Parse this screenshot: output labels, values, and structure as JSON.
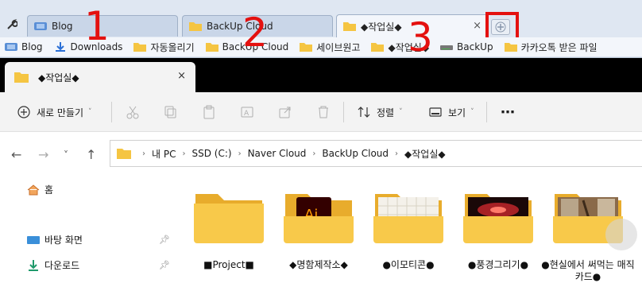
{
  "browser": {
    "tabs": [
      {
        "title": "Blog",
        "icon": "blog-favicon",
        "active": false
      },
      {
        "title": "BackUp Cloud",
        "icon": "folder-icon",
        "active": false
      },
      {
        "title": "◆작업실◆",
        "icon": "folder-icon",
        "active": true
      }
    ],
    "close_glyph": "×",
    "new_tab_glyph": "+"
  },
  "bookmarks": [
    {
      "label": "Blog",
      "icon": "blog-favicon"
    },
    {
      "label": "Downloads",
      "icon": "download-icon"
    },
    {
      "label": "자동올리기",
      "icon": "folder-icon"
    },
    {
      "label": "BackUp Cloud",
      "icon": "folder-icon"
    },
    {
      "label": "세이브원고",
      "icon": "folder-icon"
    },
    {
      "label": "◆작업실◆",
      "icon": "folder-icon"
    },
    {
      "label": "BackUp",
      "icon": "drive-icon"
    },
    {
      "label": "카카오톡 받은 파일",
      "icon": "folder-icon"
    }
  ],
  "annotations": [
    "1",
    "2",
    "3"
  ],
  "explorer": {
    "tab_title": "◆작업실◆",
    "close_glyph": "×",
    "command_bar": {
      "new_label": "새로 만들기",
      "sort_label": "정렬",
      "view_label": "보기",
      "more_glyph": "⋯"
    },
    "breadcrumbs": [
      "내 PC",
      "SSD (C:)",
      "Naver Cloud",
      "BackUp Cloud",
      "◆작업실◆"
    ],
    "sidebar": [
      {
        "label": "홈",
        "icon": "home-icon"
      },
      {
        "label": "바탕 화면",
        "icon": "desktop-icon",
        "pinned": true
      },
      {
        "label": "다운로드",
        "icon": "download-icon",
        "pinned": true
      }
    ],
    "folders": [
      {
        "name": "■Project■",
        "preview": "none"
      },
      {
        "name": "◆명함제작소◆",
        "preview": "illustrator"
      },
      {
        "name": "●이모티콘●",
        "preview": "grid"
      },
      {
        "name": "●풍경그리기●",
        "preview": "red-glow"
      },
      {
        "name": "●현실에서 써먹는 매직카드●",
        "preview": "photo"
      }
    ]
  },
  "colors": {
    "annotation_red": "#e4110f",
    "folder_yellow": "#f8c94a",
    "folder_back": "#e8ac2c"
  }
}
